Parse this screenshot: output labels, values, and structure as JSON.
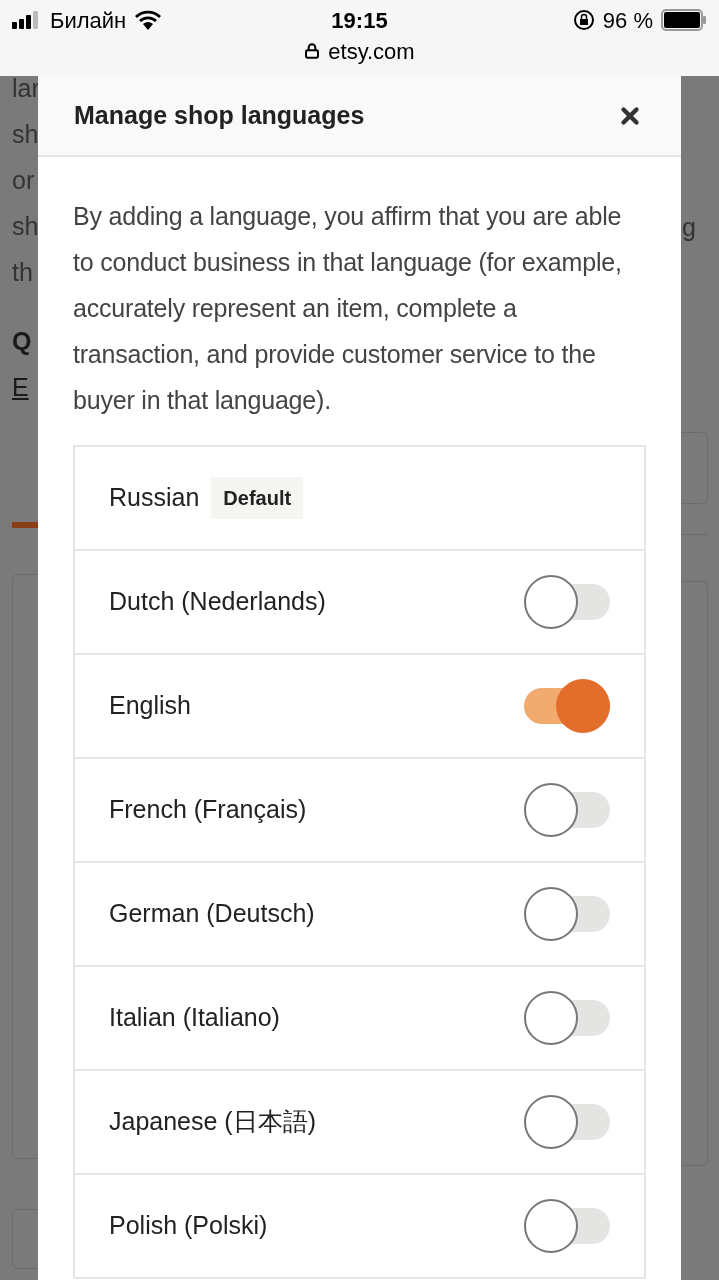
{
  "status_bar": {
    "carrier": "Билайн",
    "time": "19:15",
    "battery": "96 %",
    "url": "etsy.com"
  },
  "background": {
    "left_lines": [
      {
        "text": "lar",
        "kind": "text"
      },
      {
        "text": "sh",
        "kind": "text"
      },
      {
        "text": "or",
        "kind": "text"
      },
      {
        "text": "sh",
        "kind": "text"
      },
      {
        "text": "th",
        "kind": "text"
      },
      {
        "text": "Q",
        "kind": "bold"
      },
      {
        "text": "E",
        "kind": "link"
      }
    ],
    "right_lines": [
      {
        "text": "g",
        "kind": "text"
      }
    ]
  },
  "dialog": {
    "title": "Manage shop languages",
    "description": "By adding a language, you affirm that you are able to conduct business in that language (for example, accurately represent an item, complete a transaction, and provide customer service to the buyer in that language).",
    "languages": [
      {
        "name": "Russian",
        "kind": "default",
        "badge": "Default"
      },
      {
        "name": "Dutch (Nederlands)",
        "kind": "toggle",
        "on": false
      },
      {
        "name": "English",
        "kind": "toggle",
        "on": true
      },
      {
        "name": "French (Français)",
        "kind": "toggle",
        "on": false
      },
      {
        "name": "German (Deutsch)",
        "kind": "toggle",
        "on": false
      },
      {
        "name": "Italian (Italiano)",
        "kind": "toggle",
        "on": false
      },
      {
        "name": "Japanese (日本語)",
        "kind": "toggle",
        "on": false
      },
      {
        "name": "Polish (Polski)",
        "kind": "toggle",
        "on": false
      }
    ]
  }
}
